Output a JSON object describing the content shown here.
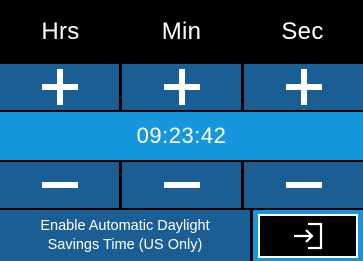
{
  "header": {
    "hours_label": "Hrs",
    "minutes_label": "Min",
    "seconds_label": "Sec"
  },
  "time": {
    "value": "09:23:42"
  },
  "dst": {
    "line1": "Enable Automatic Daylight",
    "line2": "Savings Time (US Only)"
  },
  "icons": {
    "increment": "plus-icon",
    "decrement": "minus-icon",
    "enter": "enter-icon"
  },
  "colors": {
    "button_dark_blue": "#1b5e93",
    "highlight_blue": "#1696dc",
    "background": "#000000",
    "text": "#ffffff"
  }
}
